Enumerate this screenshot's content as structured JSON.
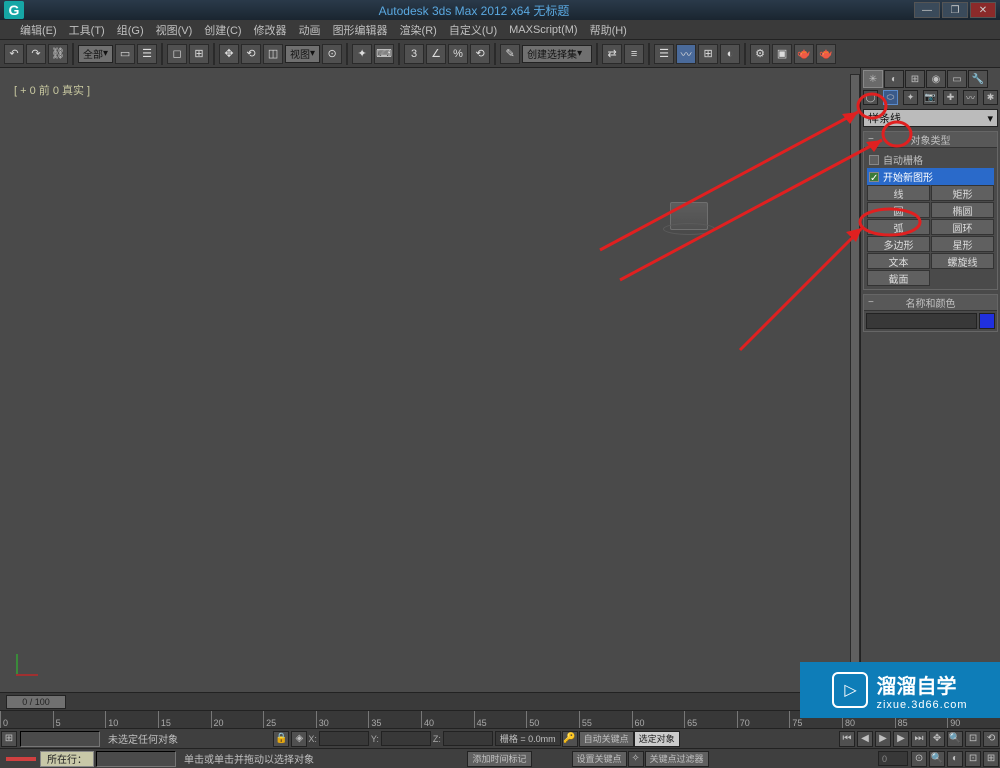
{
  "title": "Autodesk 3ds Max 2012 x64   无标题",
  "menus": [
    "编辑(E)",
    "工具(T)",
    "组(G)",
    "视图(V)",
    "创建(C)",
    "修改器",
    "动画",
    "图形编辑器",
    "渲染(R)",
    "自定义(U)",
    "MAXScript(M)",
    "帮助(H)"
  ],
  "toolbar": {
    "all_combo": "全部",
    "view_combo": "视图",
    "selset_combo": "创建选择集"
  },
  "viewport_label": "[ + 0 前 0 真实 ]",
  "cmd": {
    "dropdown": "样条线",
    "rollout1_title": "对象类型",
    "auto_grid": "自动栅格",
    "start_shape": "开始新图形",
    "buttons": [
      [
        "线",
        "矩形"
      ],
      [
        "圆",
        "椭圆"
      ],
      [
        "弧",
        "圆环"
      ],
      [
        "多边形",
        "星形"
      ],
      [
        "文本",
        "螺旋线"
      ],
      [
        "截面",
        ""
      ]
    ],
    "rollout2_title": "名称和颜色"
  },
  "timeline": {
    "handle": "0 / 100",
    "ticks": [
      "0",
      "5",
      "10",
      "15",
      "20",
      "25",
      "30",
      "35",
      "40",
      "45",
      "50",
      "55",
      "60",
      "65",
      "70",
      "75",
      "80",
      "85",
      "90"
    ]
  },
  "status": {
    "no_sel": "未选定任何对象",
    "hint": "单击或单击并拖动以选择对象",
    "x": "X:",
    "y": "Y:",
    "z": "Z:",
    "grid": "栅格 = 0.0mm",
    "auto_key": "自动关键点",
    "sel_set": "选定对象",
    "set_key": "设置关键点",
    "key_filter": "关键点过滤器",
    "row_label": "所在行：",
    "add_marker": "添加时间标记"
  },
  "watermark": {
    "title": "溜溜自学",
    "sub": "zixue.3d66.com"
  }
}
